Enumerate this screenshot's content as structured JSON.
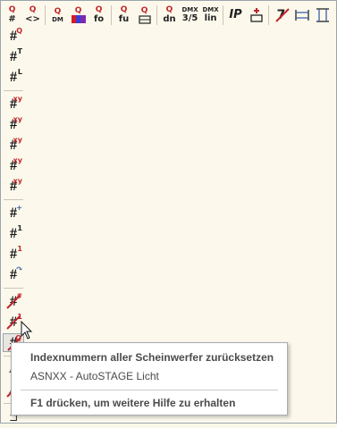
{
  "toolbar_top": {
    "items": [
      {
        "main": "#",
        "q": "Q"
      },
      {
        "main": "<>",
        "q": "Q"
      },
      {
        "main": "DM",
        "q": "Q"
      },
      {
        "main": "",
        "q": "Q"
      },
      {
        "main": "fo",
        "q": "Q"
      },
      {
        "main": "fu",
        "q": "Q"
      },
      {
        "main": "",
        "q": "Q"
      },
      {
        "main": "dn",
        "q": "Q"
      },
      {
        "top": "DMX",
        "bottom": "3/5"
      },
      {
        "top": "DMX",
        "bottom": "lin"
      },
      {
        "main": "IP"
      },
      {
        "main": ""
      },
      {
        "main": "7"
      },
      {
        "main": ""
      },
      {
        "main": ""
      }
    ]
  },
  "toolbar_left": {
    "group1": [
      {
        "glyph": "#",
        "sup": "Q"
      },
      {
        "glyph": "#",
        "sup": "T"
      },
      {
        "glyph": "#",
        "sup": "L"
      }
    ],
    "group2": [
      {
        "glyph": "#",
        "sup": "xy"
      },
      {
        "glyph": "#",
        "sup": "xy"
      },
      {
        "glyph": "#",
        "sup": "xy"
      },
      {
        "glyph": "#",
        "sup": "xy"
      },
      {
        "glyph": "#",
        "sup": "xy"
      }
    ],
    "group3": [
      {
        "glyph": "#",
        "sup": "+"
      },
      {
        "glyph": "#",
        "sup": "1"
      },
      {
        "glyph": "#",
        "sup": "1"
      },
      {
        "glyph": "#",
        "sup": "↷"
      }
    ],
    "group4": [
      {
        "glyph": "#",
        "sup": "#"
      },
      {
        "glyph": "#",
        "sup": "1"
      },
      {
        "glyph": "#",
        "sup": "Q"
      }
    ],
    "group5": [
      {
        "glyph": "A"
      },
      {
        "glyph": "A"
      }
    ],
    "group6": [
      {
        "glyph": "⊐"
      }
    ]
  },
  "tooltip": {
    "title": "Indexnummern aller Scheinwerfer zurücksetzen",
    "subtitle": "ASNXX - AutoSTAGE Licht",
    "help": "F1 drücken, um weitere Hilfe zu erhalten"
  },
  "colors": {
    "background": "#fcf9ec",
    "accent_red": "#c0262c",
    "tooltip_text": "#4b4b4b"
  }
}
